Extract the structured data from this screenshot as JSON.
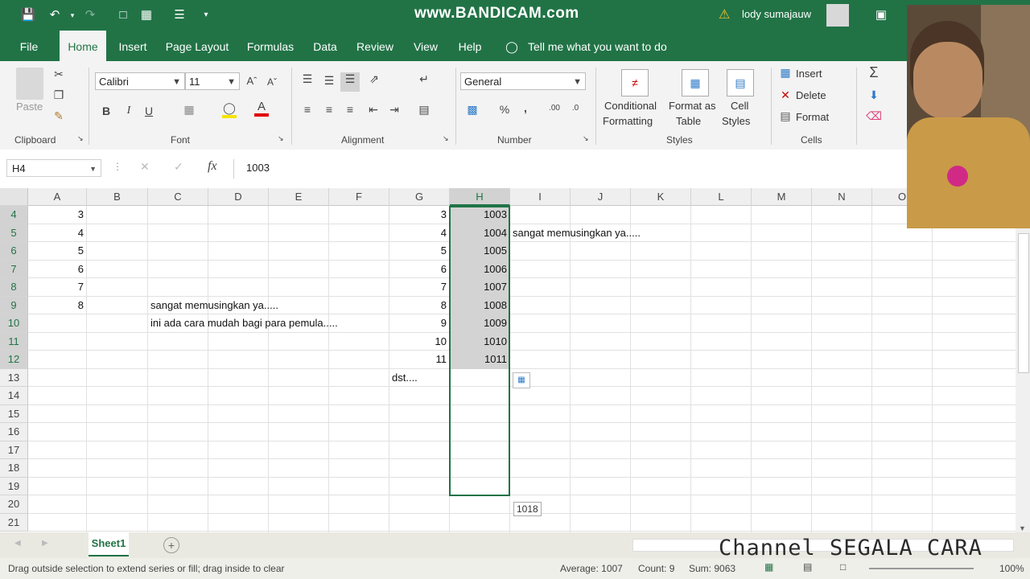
{
  "watermark": "www.BANDICAM.com",
  "user": {
    "name": "lody sumajauw"
  },
  "tabs": [
    {
      "label": "File"
    },
    {
      "label": "Home"
    },
    {
      "label": "Insert"
    },
    {
      "label": "Page Layout"
    },
    {
      "label": "Formulas"
    },
    {
      "label": "Data"
    },
    {
      "label": "Review"
    },
    {
      "label": "View"
    },
    {
      "label": "Help"
    }
  ],
  "tell_me": "Tell me what you want to do",
  "ribbon": {
    "clipboard": {
      "paste": "Paste",
      "label": "Clipboard"
    },
    "font": {
      "name": "Calibri",
      "size": "11",
      "bold": "B",
      "italic": "I",
      "underline": "U",
      "label": "Font"
    },
    "alignment": {
      "label": "Alignment"
    },
    "number": {
      "format": "General",
      "percent": "%",
      "comma": ",",
      "label": "Number"
    },
    "styles": {
      "cond1": "Conditional",
      "cond2": "Formatting",
      "fmt1": "Format as",
      "fmt2": "Table",
      "cell1": "Cell",
      "cell2": "Styles",
      "label": "Styles"
    },
    "cells": {
      "insert": "Insert",
      "delete": "Delete",
      "format": "Format",
      "label": "Cells"
    }
  },
  "formula_bar": {
    "name_box": "H4",
    "fx": "fx",
    "value": "1003"
  },
  "columns": [
    "A",
    "B",
    "C",
    "D",
    "E",
    "F",
    "G",
    "H",
    "I",
    "J",
    "K",
    "L",
    "M",
    "N",
    "O"
  ],
  "rows": [
    "4",
    "5",
    "6",
    "7",
    "8",
    "9",
    "10",
    "11",
    "12",
    "13",
    "14",
    "15",
    "16",
    "17",
    "18",
    "19",
    "20",
    "21"
  ],
  "cells": {
    "A": [
      "3",
      "4",
      "5",
      "6",
      "7",
      "8"
    ],
    "G": [
      "3",
      "4",
      "5",
      "6",
      "7",
      "8",
      "9",
      "10",
      "11"
    ],
    "H": [
      "1003",
      "1004",
      "1005",
      "1006",
      "1007",
      "1008",
      "1009",
      "1010",
      "1011"
    ],
    "I5": "sangat memusingkan ya.....",
    "C9": "sangat memusingkan ya.....",
    "C10": "ini ada cara mudah bagi para pemula.....",
    "G13": "dst...."
  },
  "fill_tooltip": "1018",
  "sheet": {
    "name": "Sheet1"
  },
  "channel_text": "Channel SEGALA CARA",
  "status": {
    "message": "Drag outside selection to extend series or fill; drag inside to clear",
    "average": "Average: 1007",
    "count": "Count: 9",
    "sum": "Sum: 9063",
    "zoom": "100%"
  },
  "colors": {
    "excel_green": "#217346",
    "selection_gray": "#d3d3d3"
  }
}
